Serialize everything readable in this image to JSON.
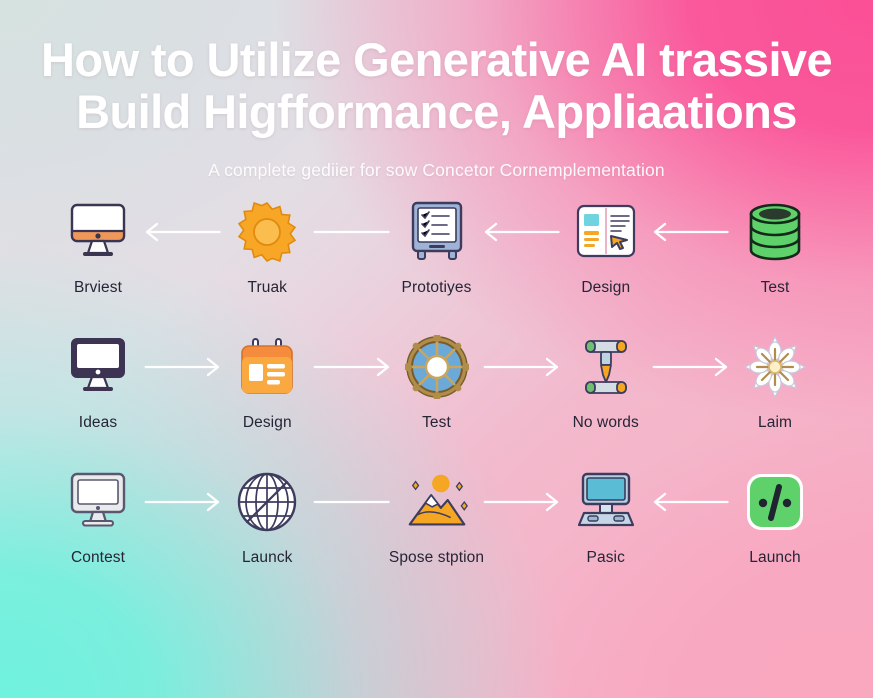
{
  "header": {
    "title_line1": "How to Utilize Generative AI trassive",
    "title_line2": "Build Higfformance, Appliaations",
    "subtitle": "A complete gediier for sow Concetor Cornemplementation"
  },
  "colors": {
    "title_text": "#ffffff",
    "label_text": "#262536",
    "arrow": "#ffffff",
    "accent_orange": "#f5a623",
    "accent_green": "#5fd16a",
    "accent_blue": "#6aa9d8",
    "accent_cyan": "#6ff2de",
    "accent_pink": "#fb4f96",
    "bg_top_left": "#d6e2e0",
    "bg_top_right": "#fb4f96",
    "bg_bottom_left": "#6ff2de",
    "bg_bottom_right": "#f9a8c0"
  },
  "rows": [
    {
      "name": "row-1",
      "nodes": [
        {
          "label": "Brviest",
          "icon": "monitor-orange-icon"
        },
        {
          "label": "Truak",
          "icon": "gear-orange-icon"
        },
        {
          "label": "Prototiyes",
          "icon": "tablet-checklist-icon"
        },
        {
          "label": "Design",
          "icon": "document-cursor-icon"
        },
        {
          "label": "Test",
          "icon": "database-green-icon"
        }
      ],
      "connectors": [
        {
          "icon": "arrow-left-icon",
          "direction": "left"
        },
        {
          "icon": "line-plain-icon",
          "direction": "none"
        },
        {
          "icon": "arrow-left-icon",
          "direction": "left"
        },
        {
          "icon": "arrow-left-icon",
          "direction": "left"
        }
      ]
    },
    {
      "name": "row-2",
      "nodes": [
        {
          "label": "Ideas",
          "icon": "monitor-dark-icon"
        },
        {
          "label": "Design",
          "icon": "calendar-orange-icon"
        },
        {
          "label": "Test",
          "icon": "wheel-blue-icon"
        },
        {
          "label": "No words",
          "icon": "tool-clamp-icon"
        },
        {
          "label": "Laim",
          "icon": "snowflake-icon"
        }
      ],
      "connectors": [
        {
          "icon": "arrow-right-icon",
          "direction": "right"
        },
        {
          "icon": "arrow-right-icon",
          "direction": "right"
        },
        {
          "icon": "arrow-right-icon",
          "direction": "right"
        },
        {
          "icon": "arrow-right-icon",
          "direction": "right"
        }
      ]
    },
    {
      "name": "row-3",
      "nodes": [
        {
          "label": "Contest",
          "icon": "monitor-gray-icon"
        },
        {
          "label": "Launck",
          "icon": "globe-wire-icon"
        },
        {
          "label": "Spose stption",
          "icon": "mountain-sun-icon"
        },
        {
          "label": "Pasic",
          "icon": "desktop-blue-icon"
        },
        {
          "label": "Launch",
          "icon": "code-green-icon"
        }
      ],
      "connectors": [
        {
          "icon": "arrow-right-icon",
          "direction": "right"
        },
        {
          "icon": "line-plain-icon",
          "direction": "none"
        },
        {
          "icon": "arrow-right-icon",
          "direction": "right"
        },
        {
          "icon": "arrow-left-icon",
          "direction": "left"
        }
      ]
    }
  ]
}
